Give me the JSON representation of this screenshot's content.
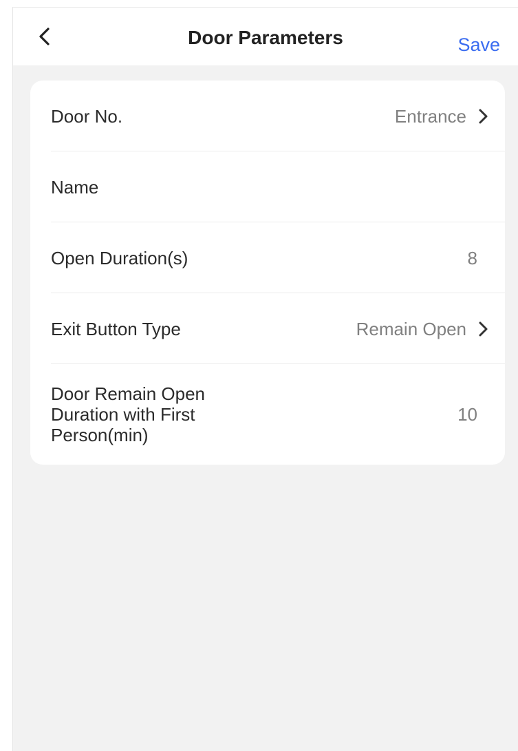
{
  "nav": {
    "back_icon": "chevron-left-icon",
    "title": "Door Parameters",
    "save_label": "Save",
    "accent_color": "#3a6cf0"
  },
  "rows": [
    {
      "label": "Door No.",
      "value": "Entrance",
      "icon": "chevron-right-icon"
    },
    {
      "label": "Name",
      "value": ""
    },
    {
      "label": "Open Duration(s)",
      "value": "8"
    },
    {
      "label": "Exit Button Type",
      "value": "Remain Open",
      "icon": "chevron-right-icon"
    },
    {
      "label": "Door Remain Open Duration with First Person(min)",
      "value": "10"
    }
  ]
}
